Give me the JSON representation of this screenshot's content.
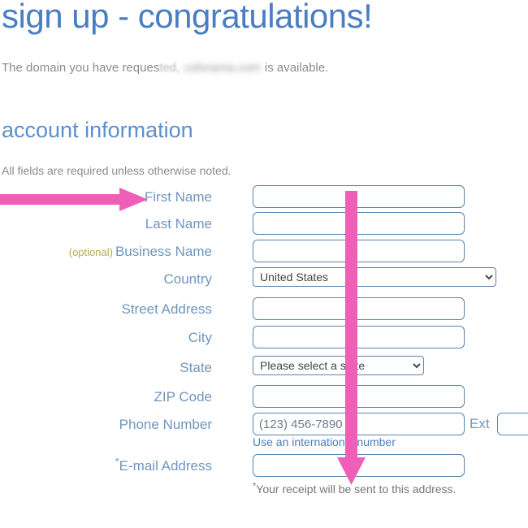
{
  "page": {
    "title": "sign up - congratulations!",
    "domain_line": {
      "prefix": "The domain you have reques",
      "fade_tail": "ted,",
      "redacted_domain": "colorama.com",
      "suffix": "is available."
    },
    "section_title": "account information",
    "required_note": "All fields are required unless otherwise noted."
  },
  "form": {
    "rows": [
      {
        "label": "First Name",
        "optional": "",
        "star": "",
        "control": "text",
        "value": "",
        "placeholder": ""
      },
      {
        "label": "Last Name",
        "optional": "",
        "star": "",
        "control": "text",
        "value": "",
        "placeholder": ""
      },
      {
        "label": "Business Name",
        "optional": "(optional)",
        "star": "",
        "control": "text",
        "value": "",
        "placeholder": ""
      },
      {
        "label": "Country",
        "optional": "",
        "star": "",
        "control": "select",
        "value": "United States",
        "placeholder": ""
      },
      {
        "label": "Street Address",
        "optional": "",
        "star": "",
        "control": "text",
        "value": "",
        "placeholder": ""
      },
      {
        "label": "City",
        "optional": "",
        "star": "",
        "control": "text",
        "value": "",
        "placeholder": ""
      },
      {
        "label": "State",
        "optional": "",
        "star": "",
        "control": "select",
        "value": "Please select a state",
        "placeholder": ""
      },
      {
        "label": "ZIP Code",
        "optional": "",
        "star": "",
        "control": "text",
        "value": "",
        "placeholder": ""
      },
      {
        "label": "Phone Number",
        "optional": "",
        "star": "",
        "control": "phone",
        "value": "",
        "placeholder": "(123) 456-7890"
      },
      {
        "label": "E-mail Address",
        "optional": "",
        "star": "*",
        "control": "text",
        "value": "",
        "placeholder": ""
      }
    ],
    "ext_label": "Ext",
    "ext_value": "",
    "phone_hint": "Use an international number",
    "email_hint_star": "*",
    "email_hint": "Your receipt will be sent to this address.",
    "country_options": [
      "United States"
    ],
    "state_options": [
      "Please select a state"
    ]
  },
  "annotations": {
    "arrow_color": "#ef5fb8",
    "horizontal_arrow_target": "First Name",
    "vertical_arrow_target": "E-mail Address"
  },
  "colors": {
    "title_blue": "#4a7ec2",
    "section_blue": "#5b8fcf",
    "label_blue": "#6f96bd",
    "optional_olive": "#b9aa4d",
    "field_border": "#5b83ab",
    "muted_text": "#8c8c8c",
    "arrow_pink": "#ef5fb8"
  }
}
